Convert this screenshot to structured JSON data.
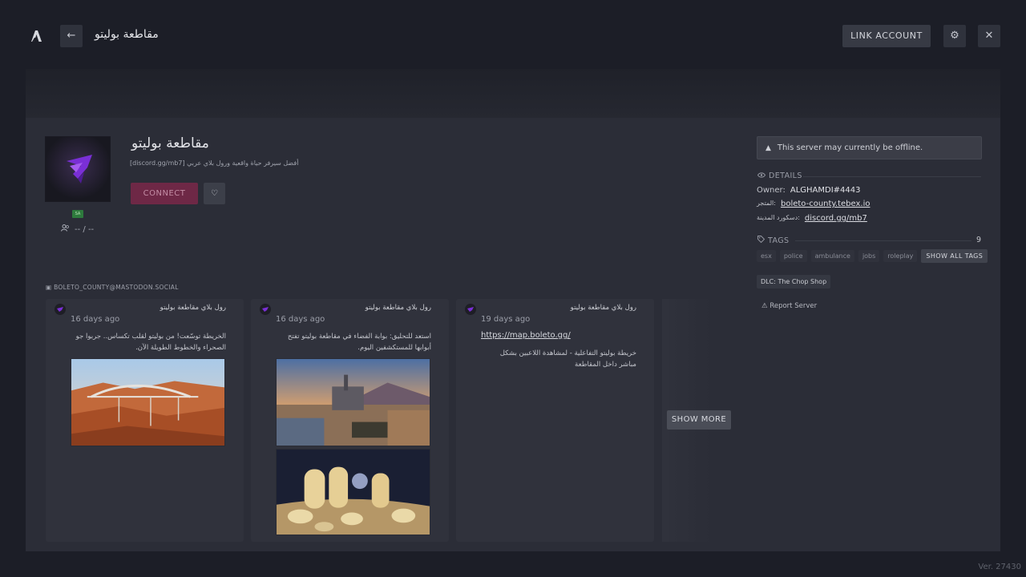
{
  "header": {
    "logo_icon": "cfx-logo-icon",
    "back_icon": "←",
    "title": "مقاطعة بوليتو",
    "link_account_label": "LINK ACCOUNT",
    "settings_icon": "⚙",
    "close_icon": "✕"
  },
  "server": {
    "name": "مقاطعة بوليتو",
    "description": "[discord.gg/mb7] أفضل سيرفر حياة واقعية ورول بلاي عربي",
    "connect_label": "CONNECT",
    "favorite_icon": "♡",
    "flag_label": "SA",
    "players": "-- / --"
  },
  "info": {
    "offline_warning": "This server may currently be offline.",
    "details_label": "DETAILS",
    "owner_label": "Owner:",
    "owner_value": "ALGHAMDI#4443",
    "store_label": "المتجر:",
    "store_value": "boleto-county.tebex.io",
    "discord_label": "دسكورد المدينة:",
    "discord_value": "discord.gg/mb7",
    "tags_label": "TAGS",
    "tags_count": "9",
    "tags": [
      "esx",
      "police",
      "ambulance",
      "jobs",
      "roleplay"
    ],
    "show_all_tags_label": "SHOW ALL TAGS",
    "dlc_label": "DLC: The Chop Shop",
    "report_label": "Report Server"
  },
  "feed": {
    "account": "BOLETO_COUNTY@MASTODON.SOCIAL",
    "show_more_label": "SHOW MORE",
    "posts": [
      {
        "author": "رول بلاي مقاطعة بوليتو",
        "date": "16 days ago",
        "text": "الخريطة توسّعت! من بوليتو لقلب تكساس.. جربوا جو الصحراء والخطوط الطويلة الآن."
      },
      {
        "author": "رول بلاي مقاطعة بوليتو",
        "date": "16 days ago",
        "text": "استعد للتحليق: بوابة الفضاء في مقاطعة بوليتو تفتح أبوابها للمستكشفين اليوم."
      },
      {
        "author": "رول بلاي مقاطعة بوليتو",
        "date": "19 days ago",
        "link": "https://map.boleto.gg/",
        "text": "خريطة بوليتو التفاعلية - لمشاهدة اللاعبين بشكل مباشر داخل المقاطعة"
      }
    ]
  },
  "version": "Ver. 27430"
}
